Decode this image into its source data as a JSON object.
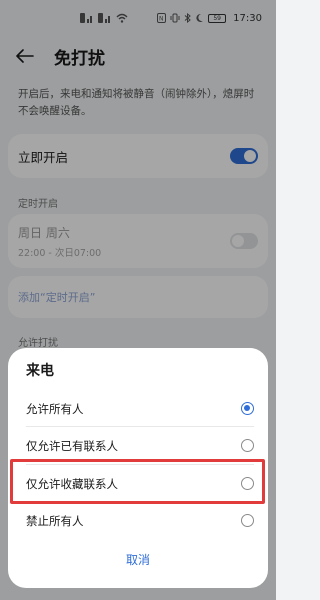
{
  "status_bar": {
    "left_icons": [
      "sim1-icon",
      "sim2-icon",
      "wifi-icon"
    ],
    "right_icons": [
      "nfc-icon",
      "vibrate-icon",
      "bluetooth-icon",
      "moon-icon"
    ],
    "battery": "59",
    "time": "17:30"
  },
  "header": {
    "back_icon": "arrow-left-icon",
    "title": "免打扰"
  },
  "description": "开启后，来电和通知将被静音（闹钟除外），熄屏时不会唤醒设备。",
  "immediate": {
    "label": "立即开启",
    "enabled": true
  },
  "schedule_section_label": "定时开启",
  "schedule": {
    "days": "周日 周六",
    "time_range": "22:00 - 次日07:00",
    "enabled": false
  },
  "add_schedule_label": "添加“定时开启”",
  "allow_section_label": "允许打扰",
  "sheet": {
    "title": "来电",
    "options": [
      {
        "label": "允许所有人",
        "selected": true
      },
      {
        "label": "仅允许已有联系人",
        "selected": false
      },
      {
        "label": "仅允许收藏联系人",
        "selected": false
      },
      {
        "label": "禁止所有人",
        "selected": false
      }
    ],
    "cancel_label": "取消"
  },
  "colors": {
    "accent": "#2f6ed8",
    "highlight": "#e23b3b"
  }
}
